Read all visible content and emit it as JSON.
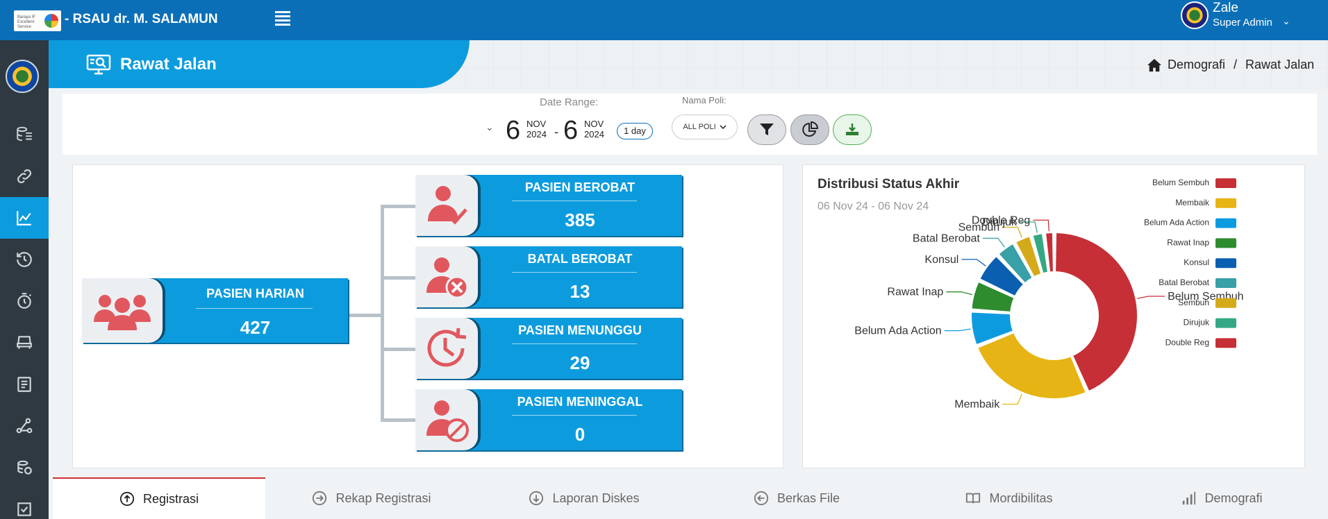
{
  "header": {
    "logo_text": "Baraya IF Excellent Service",
    "app_title": "- RSAU dr. M. SALAMUN",
    "user_name": "Zale",
    "user_role": "Super Admin"
  },
  "sidebar": {
    "items": [
      {
        "icon": "database-list-icon",
        "active": false
      },
      {
        "icon": "link-icon",
        "active": false
      },
      {
        "icon": "line-chart-icon",
        "active": true
      },
      {
        "icon": "history-icon",
        "active": false
      },
      {
        "icon": "timer-icon",
        "active": false
      },
      {
        "icon": "bed-icon",
        "active": false
      },
      {
        "icon": "report-icon",
        "active": false
      },
      {
        "icon": "workflow-icon",
        "active": false
      },
      {
        "icon": "billing-icon",
        "active": false
      },
      {
        "icon": "checkbox-icon",
        "active": false
      }
    ]
  },
  "page": {
    "title": "Rawat Jalan",
    "breadcrumb": [
      "Demografi",
      "/",
      "Rawat Jalan"
    ]
  },
  "filters": {
    "date_range_label": "Date Range:",
    "start_day": "6",
    "start_month": "NOV",
    "start_year": "2024",
    "separator": "-",
    "end_day": "6",
    "end_month": "NOV",
    "end_year": "2024",
    "duration_chip": "1 day",
    "poli_label": "Nama Poli:",
    "poli_value": "ALL POLI"
  },
  "stats": {
    "root": {
      "label": "PASIEN HARIAN",
      "value": "427"
    },
    "branches": [
      {
        "label": "PASIEN BEROBAT",
        "value": "385",
        "icon": "user-check-icon"
      },
      {
        "label": "BATAL BEROBAT",
        "value": "13",
        "icon": "user-cancel-icon"
      },
      {
        "label": "PASIEN MENUNGGU",
        "value": "29",
        "icon": "clock-wait-icon"
      },
      {
        "label": "PASIEN MENINGGAL",
        "value": "0",
        "icon": "user-block-icon"
      }
    ]
  },
  "chart_data": {
    "type": "pie",
    "donut": true,
    "title": "Distribusi Status Akhir",
    "subtitle": "06 Nov 24 - 06 Nov 24",
    "categories": [
      "Belum Sembuh",
      "Membaik",
      "Belum Ada Action",
      "Rawat Inap",
      "Konsul",
      "Batal Berobat",
      "Sembuh",
      "Dirujuk",
      "Double Reg"
    ],
    "values": [
      43.5,
      25.5,
      7,
      6,
      6,
      4,
      3.5,
      2.5,
      2
    ],
    "colors": [
      "#c62f36",
      "#e6b414",
      "#0d9be0",
      "#2e8b2e",
      "#0b5fb0",
      "#38a0a6",
      "#d4aa1a",
      "#34a885",
      "#c62f36"
    ],
    "legend_position": "right"
  },
  "tabs": [
    {
      "label": "Registrasi",
      "icon": "arrow-up-circle-icon",
      "active": true
    },
    {
      "label": "Rekap Registrasi",
      "icon": "arrow-right-circle-icon",
      "active": false
    },
    {
      "label": "Laporan Diskes",
      "icon": "arrow-down-circle-icon",
      "active": false
    },
    {
      "label": "Berkas File",
      "icon": "arrow-left-circle-icon",
      "active": false
    },
    {
      "label": "Mordibilitas",
      "icon": "book-icon",
      "active": false
    },
    {
      "label": "Demografi",
      "icon": "bars-icon",
      "active": false
    }
  ]
}
